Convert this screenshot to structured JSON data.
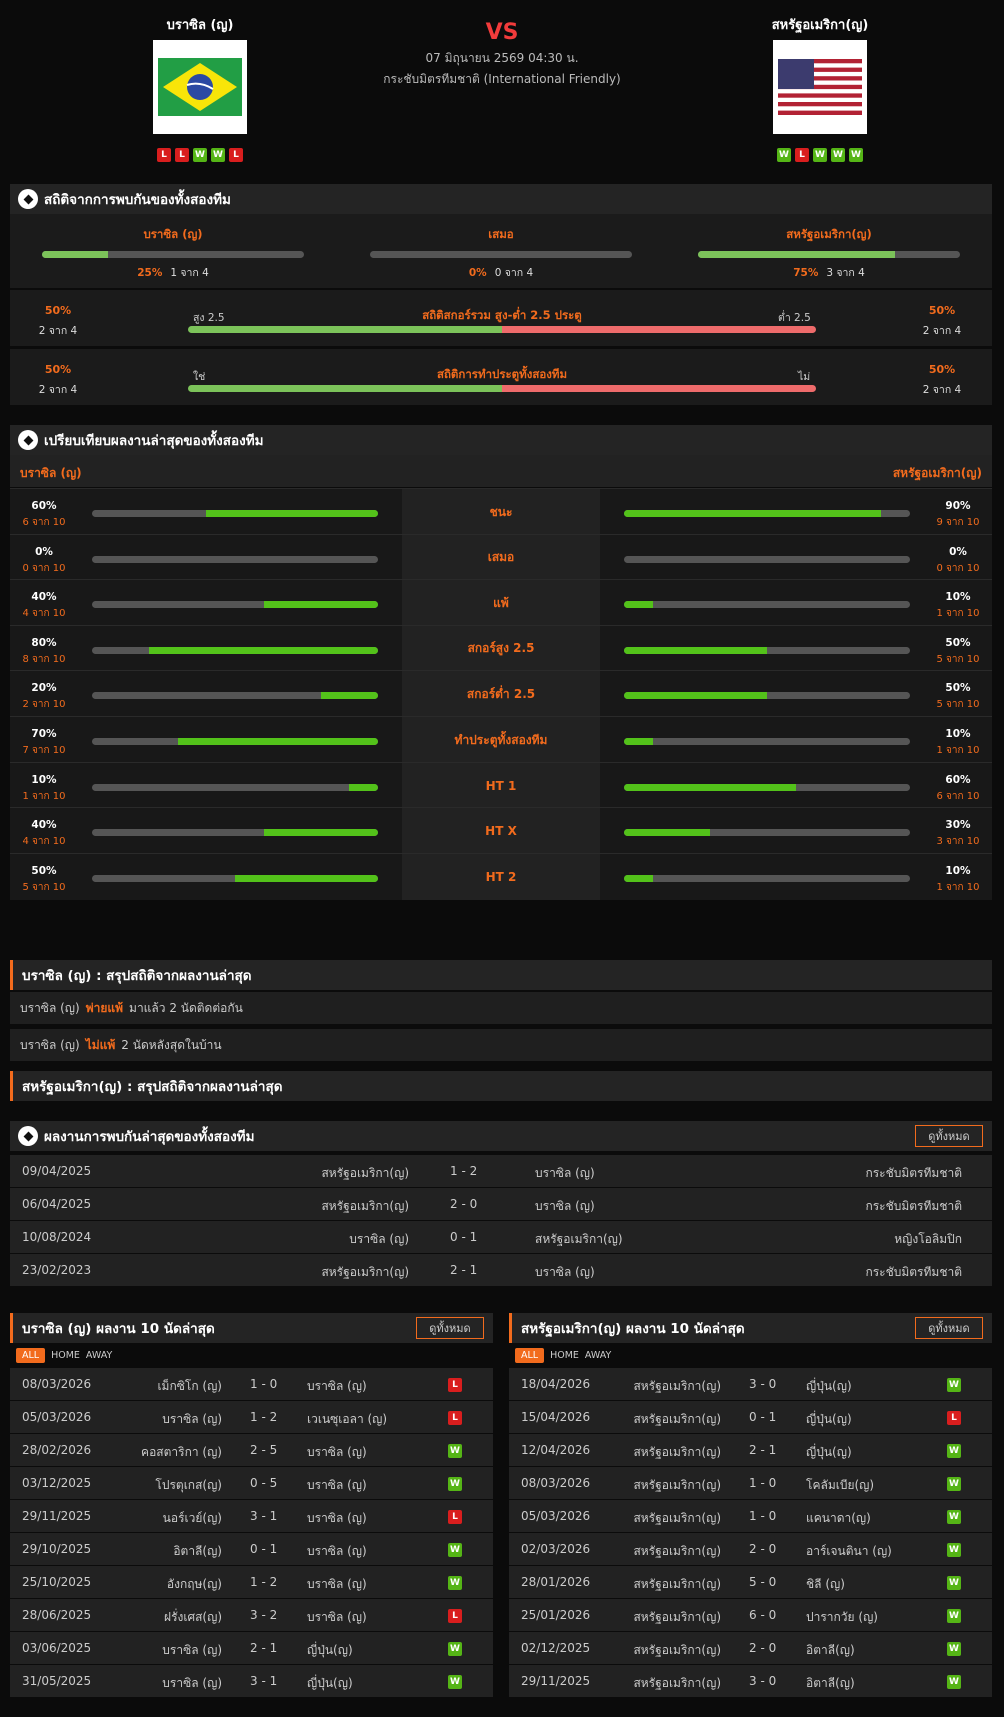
{
  "match": {
    "vs": "VS",
    "datetime": "07 มิถุนายน 2569 04:30 น.",
    "competition": "กระชับมิตรทีมชาติ (International Friendly)",
    "home": {
      "name": "บราซิล (ญ)",
      "form": [
        "L",
        "L",
        "W",
        "W",
        "L"
      ]
    },
    "away": {
      "name": "สหรัฐอเมริกา(ญ)",
      "form": [
        "W",
        "L",
        "W",
        "W",
        "W"
      ]
    }
  },
  "h2h_stats": {
    "title": "สถิติจากการพบกันของทั้งสองทีม",
    "cols": [
      {
        "label": "บราซิล (ญ)",
        "pct": "25%",
        "count": "1 จาก 4",
        "fill": 25
      },
      {
        "label": "เสมอ",
        "pct": "0%",
        "count": "0 จาก 4",
        "fill": 0
      },
      {
        "label": "สหรัฐอเมริกา(ญ)",
        "pct": "75%",
        "count": "3 จาก 4",
        "fill": 75
      }
    ],
    "ou": {
      "left_pct": "50%",
      "left_count": "2 จาก 4",
      "left_label": "สูง 2.5",
      "title": "สถิติสกอร์รวม สูง-ต่ำ 2.5 ประตู",
      "right_label": "ต่ำ 2.5",
      "right_pct": "50%",
      "right_count": "2 จาก 4",
      "split": 50
    },
    "btts": {
      "left_pct": "50%",
      "left_count": "2 จาก 4",
      "left_label": "ใช่",
      "title": "สถิติการทำประตูทั้งสองทีม",
      "right_label": "ไม่",
      "right_pct": "50%",
      "right_count": "2 จาก 4",
      "split": 50
    }
  },
  "compare": {
    "title": "เปรียบเทียบผลงานล่าสุดของทั้งสองทีม",
    "home_label": "บราซิล (ญ)",
    "away_label": "สหรัฐอเมริกา(ญ)",
    "rows": [
      {
        "label": "ชนะ",
        "h_pct": "60%",
        "h_cnt": "6 จาก 10",
        "h": 60,
        "a_pct": "90%",
        "a_cnt": "9 จาก 10",
        "a": 90
      },
      {
        "label": "เสมอ",
        "h_pct": "0%",
        "h_cnt": "0 จาก 10",
        "h": 0,
        "a_pct": "0%",
        "a_cnt": "0 จาก 10",
        "a": 0
      },
      {
        "label": "แพ้",
        "h_pct": "40%",
        "h_cnt": "4 จาก 10",
        "h": 40,
        "a_pct": "10%",
        "a_cnt": "1 จาก 10",
        "a": 10
      },
      {
        "label": "สกอร์สูง 2.5",
        "h_pct": "80%",
        "h_cnt": "8 จาก 10",
        "h": 80,
        "a_pct": "50%",
        "a_cnt": "5 จาก 10",
        "a": 50
      },
      {
        "label": "สกอร์ต่ำ 2.5",
        "h_pct": "20%",
        "h_cnt": "2 จาก 10",
        "h": 20,
        "a_pct": "50%",
        "a_cnt": "5 จาก 10",
        "a": 50
      },
      {
        "label": "ทำประตูทั้งสองทีม",
        "h_pct": "70%",
        "h_cnt": "7 จาก 10",
        "h": 70,
        "a_pct": "10%",
        "a_cnt": "1 จาก 10",
        "a": 10
      },
      {
        "label": "HT 1",
        "h_pct": "10%",
        "h_cnt": "1 จาก 10",
        "h": 10,
        "a_pct": "60%",
        "a_cnt": "6 จาก 10",
        "a": 60
      },
      {
        "label": "HT X",
        "h_pct": "40%",
        "h_cnt": "4 จาก 10",
        "h": 40,
        "a_pct": "30%",
        "a_cnt": "3 จาก 10",
        "a": 30
      },
      {
        "label": "HT 2",
        "h_pct": "50%",
        "h_cnt": "5 จาก 10",
        "h": 50,
        "a_pct": "10%",
        "a_cnt": "1 จาก 10",
        "a": 10
      }
    ]
  },
  "summary_home": {
    "title": "บราซิล (ญ) : สรุปสถิติจากผลงานล่าสุด",
    "rows": [
      {
        "team": "บราซิล (ญ)",
        "key": "พ่ายแพ้",
        "text": "มาแล้ว 2 นัดติดต่อกัน"
      },
      {
        "team": "บราซิล (ญ)",
        "key": "ไม่แพ้",
        "text": "2  นัดหลังสุดในบ้าน"
      }
    ]
  },
  "summary_away": {
    "title": "สหรัฐอเมริกา(ญ) : สรุปสถิติจากผลงานล่าสุด"
  },
  "history": {
    "title": "ผลงานการพบกันล่าสุดของทั้งสองทีม",
    "view_all": "ดูทั้งหมด",
    "rows": [
      {
        "date": "09/04/2025",
        "home": "สหรัฐอเมริกา(ญ)",
        "score": "1 - 2",
        "away": "บราซิล (ญ)",
        "comp": "กระชับมิตรทีมชาติ"
      },
      {
        "date": "06/04/2025",
        "home": "สหรัฐอเมริกา(ญ)",
        "score": "2 - 0",
        "away": "บราซิล (ญ)",
        "comp": "กระชับมิตรทีมชาติ"
      },
      {
        "date": "10/08/2024",
        "home": "บราซิล (ญ)",
        "score": "0 - 1",
        "away": "สหรัฐอเมริกา(ญ)",
        "comp": "หญิงโอลิมปิก"
      },
      {
        "date": "23/02/2023",
        "home": "สหรัฐอเมริกา(ญ)",
        "score": "2 - 1",
        "away": "บราซิล (ญ)",
        "comp": "กระชับมิตรทีมชาติ"
      }
    ]
  },
  "tabs": {
    "all": "ALL",
    "home": "HOME",
    "away": "AWAY"
  },
  "last10_home": {
    "title": "บราซิล (ญ) ผลงาน 10 นัดล่าสุด",
    "view_all": "ดูทั้งหมด",
    "rows": [
      {
        "date": "08/03/2026",
        "home": "เม็กซิโก (ญ)",
        "score": "1 - 0",
        "away": "บราซิล (ญ)",
        "res": "L"
      },
      {
        "date": "05/03/2026",
        "home": "บราซิล (ญ)",
        "score": "1 - 2",
        "away": "เวเนซุเอลา (ญ)",
        "res": "L"
      },
      {
        "date": "28/02/2026",
        "home": "คอสตาริกา (ญ)",
        "score": "2 - 5",
        "away": "บราซิล (ญ)",
        "res": "W"
      },
      {
        "date": "03/12/2025",
        "home": "โปรตุเกส(ญ)",
        "score": "0 - 5",
        "away": "บราซิล (ญ)",
        "res": "W"
      },
      {
        "date": "29/11/2025",
        "home": "นอร์เวย์(ญ)",
        "score": "3 - 1",
        "away": "บราซิล (ญ)",
        "res": "L"
      },
      {
        "date": "29/10/2025",
        "home": "อิตาลี(ญ)",
        "score": "0 - 1",
        "away": "บราซิล (ญ)",
        "res": "W"
      },
      {
        "date": "25/10/2025",
        "home": "อังกฤษ(ญ)",
        "score": "1 - 2",
        "away": "บราซิล (ญ)",
        "res": "W"
      },
      {
        "date": "28/06/2025",
        "home": "ฝรั่งเศส(ญ)",
        "score": "3 - 2",
        "away": "บราซิล (ญ)",
        "res": "L"
      },
      {
        "date": "03/06/2025",
        "home": "บราซิล (ญ)",
        "score": "2 - 1",
        "away": "ญี่ปุ่น(ญ)",
        "res": "W"
      },
      {
        "date": "31/05/2025",
        "home": "บราซิล (ญ)",
        "score": "3 - 1",
        "away": "ญี่ปุ่น(ญ)",
        "res": "W"
      }
    ]
  },
  "last10_away": {
    "title": "สหรัฐอเมริกา(ญ) ผลงาน 10 นัดล่าสุด",
    "view_all": "ดูทั้งหมด",
    "rows": [
      {
        "date": "18/04/2026",
        "home": "สหรัฐอเมริกา(ญ)",
        "score": "3 - 0",
        "away": "ญี่ปุ่น(ญ)",
        "res": "W"
      },
      {
        "date": "15/04/2026",
        "home": "สหรัฐอเมริกา(ญ)",
        "score": "0 - 1",
        "away": "ญี่ปุ่น(ญ)",
        "res": "L"
      },
      {
        "date": "12/04/2026",
        "home": "สหรัฐอเมริกา(ญ)",
        "score": "2 - 1",
        "away": "ญี่ปุ่น(ญ)",
        "res": "W"
      },
      {
        "date": "08/03/2026",
        "home": "สหรัฐอเมริกา(ญ)",
        "score": "1 - 0",
        "away": "โคลัมเบีย(ญ)",
        "res": "W"
      },
      {
        "date": "05/03/2026",
        "home": "สหรัฐอเมริกา(ญ)",
        "score": "1 - 0",
        "away": "แคนาดา(ญ)",
        "res": "W"
      },
      {
        "date": "02/03/2026",
        "home": "สหรัฐอเมริกา(ญ)",
        "score": "2 - 0",
        "away": "อาร์เจนตินา (ญ)",
        "res": "W"
      },
      {
        "date": "28/01/2026",
        "home": "สหรัฐอเมริกา(ญ)",
        "score": "5 - 0",
        "away": "ชิลี (ญ)",
        "res": "W"
      },
      {
        "date": "25/01/2026",
        "home": "สหรัฐอเมริกา(ญ)",
        "score": "6 - 0",
        "away": "ปารากวัย (ญ)",
        "res": "W"
      },
      {
        "date": "02/12/2025",
        "home": "สหรัฐอเมริกา(ญ)",
        "score": "2 - 0",
        "away": "อิตาลี(ญ)",
        "res": "W"
      },
      {
        "date": "29/11/2025",
        "home": "สหรัฐอเมริกา(ญ)",
        "score": "3 - 0",
        "away": "อิตาลี(ญ)",
        "res": "W"
      }
    ]
  }
}
